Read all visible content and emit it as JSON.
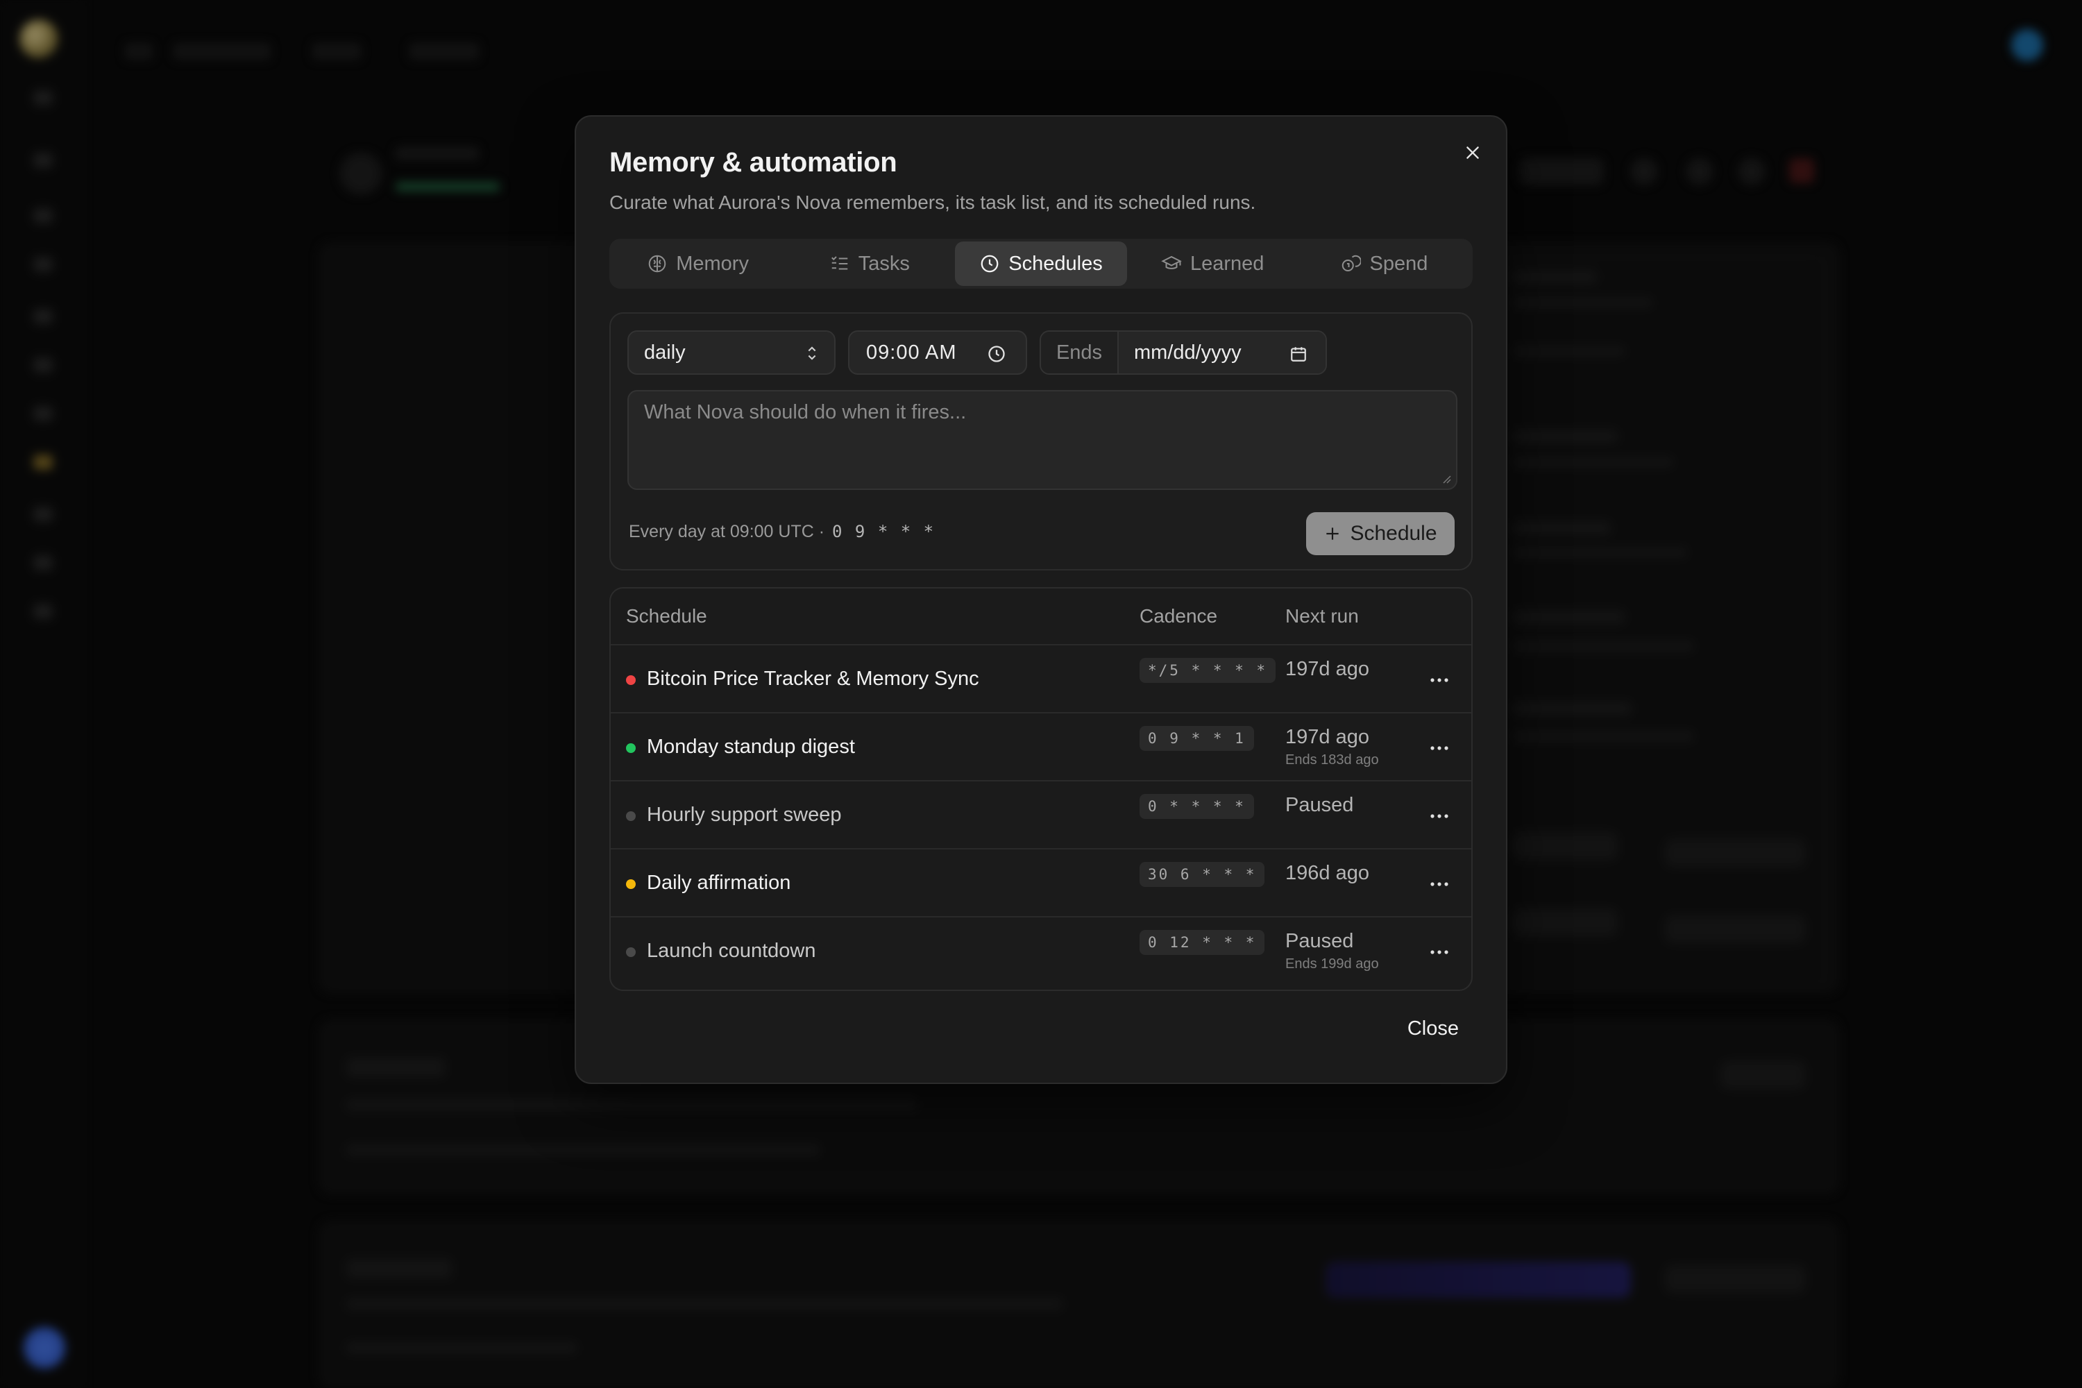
{
  "modal": {
    "title": "Memory & automation",
    "subtitle": "Curate what Aurora's Nova remembers, its task list, and its scheduled runs.",
    "close_label": "Close"
  },
  "tabs": [
    {
      "label": "Memory",
      "icon": "brain-icon"
    },
    {
      "label": "Tasks",
      "icon": "list-checks-icon"
    },
    {
      "label": "Schedules",
      "icon": "clock-icon",
      "active": true
    },
    {
      "label": "Learned",
      "icon": "graduation-cap-icon"
    },
    {
      "label": "Spend",
      "icon": "coins-icon"
    }
  ],
  "form": {
    "frequency_value": "daily",
    "time_value": "09:00 AM",
    "ends_label": "Ends",
    "ends_placeholder": "mm/dd/yyyy",
    "prompt_placeholder": "What Nova should do when it fires...",
    "summary_text": "Every day at 09:00 UTC ·",
    "summary_cron": "0 9 * * *",
    "submit_label": "Schedule"
  },
  "table": {
    "headers": {
      "schedule": "Schedule",
      "cadence": "Cadence",
      "next_run": "Next run"
    },
    "rows": [
      {
        "name": "Bitcoin Price Tracker & Memory Sync",
        "status": "error",
        "status_color": "#ef4444",
        "cadence": "*/5 * * * *",
        "next_run": "197d ago",
        "ends": ""
      },
      {
        "name": "Monday standup digest",
        "status": "active",
        "status_color": "#22c55e",
        "cadence": "0 9 * * 1",
        "next_run": "197d ago",
        "ends": "Ends 183d ago"
      },
      {
        "name": "Hourly support sweep",
        "status": "paused",
        "status_color": "#4a4a4a",
        "cadence": "0 * * * *",
        "next_run": "Paused",
        "ends": ""
      },
      {
        "name": "Daily affirmation",
        "status": "warning",
        "status_color": "#f5b80b",
        "cadence": "30 6 * * *",
        "next_run": "196d ago",
        "ends": ""
      },
      {
        "name": "Launch countdown",
        "status": "paused",
        "status_color": "#4a4a4a",
        "cadence": "0 12 * * *",
        "next_run": "Paused",
        "ends": "Ends 199d ago"
      }
    ]
  },
  "colors": {
    "modal_bg": "#1b1b1b",
    "accent_button": "#8f8f8f",
    "error": "#ef4444",
    "success": "#22c55e",
    "warning": "#f5b80b"
  }
}
